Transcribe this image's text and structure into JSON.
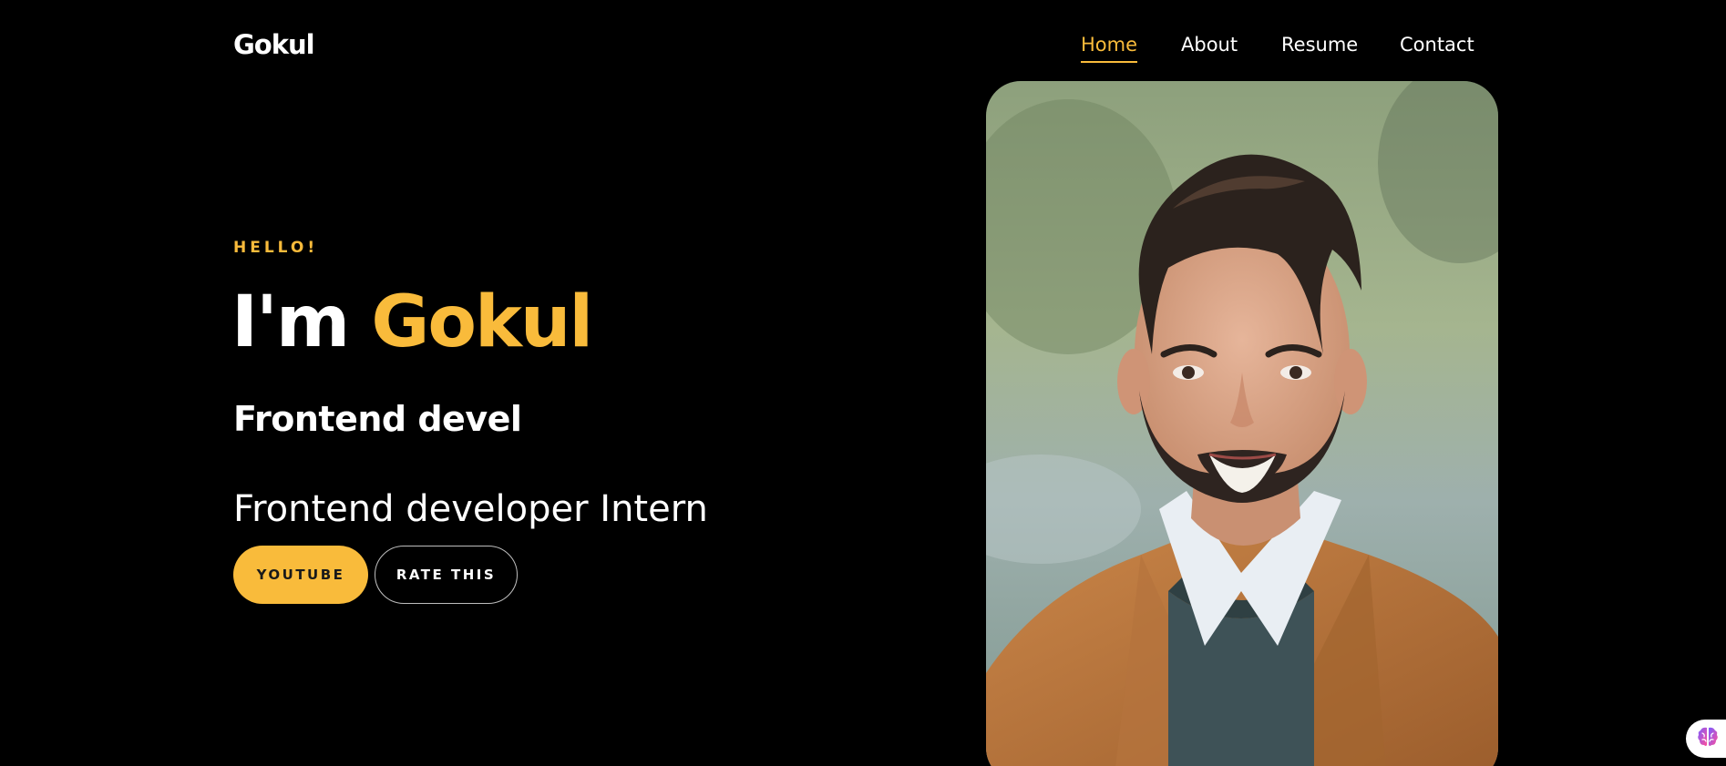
{
  "brand": {
    "name": "Gokul"
  },
  "nav": {
    "items": [
      {
        "label": "Home",
        "active": true
      },
      {
        "label": "About",
        "active": false
      },
      {
        "label": "Resume",
        "active": false
      },
      {
        "label": "Contact",
        "active": false
      }
    ]
  },
  "hero": {
    "eyebrow": "HELLO!",
    "headline_prefix": "I'm",
    "headline_name": "Gokul",
    "typed_text": "Frontend devel",
    "role": "Frontend developer Intern",
    "buttons": {
      "primary_label": "YOUTUBE",
      "secondary_label": "RATE THIS"
    }
  },
  "portrait": {
    "alt": "Portrait photo",
    "icon": "portrait-photo"
  },
  "widget": {
    "icon": "brain-icon"
  },
  "colors": {
    "accent": "#f9bb3b",
    "background": "#000000",
    "text": "#ffffff"
  }
}
